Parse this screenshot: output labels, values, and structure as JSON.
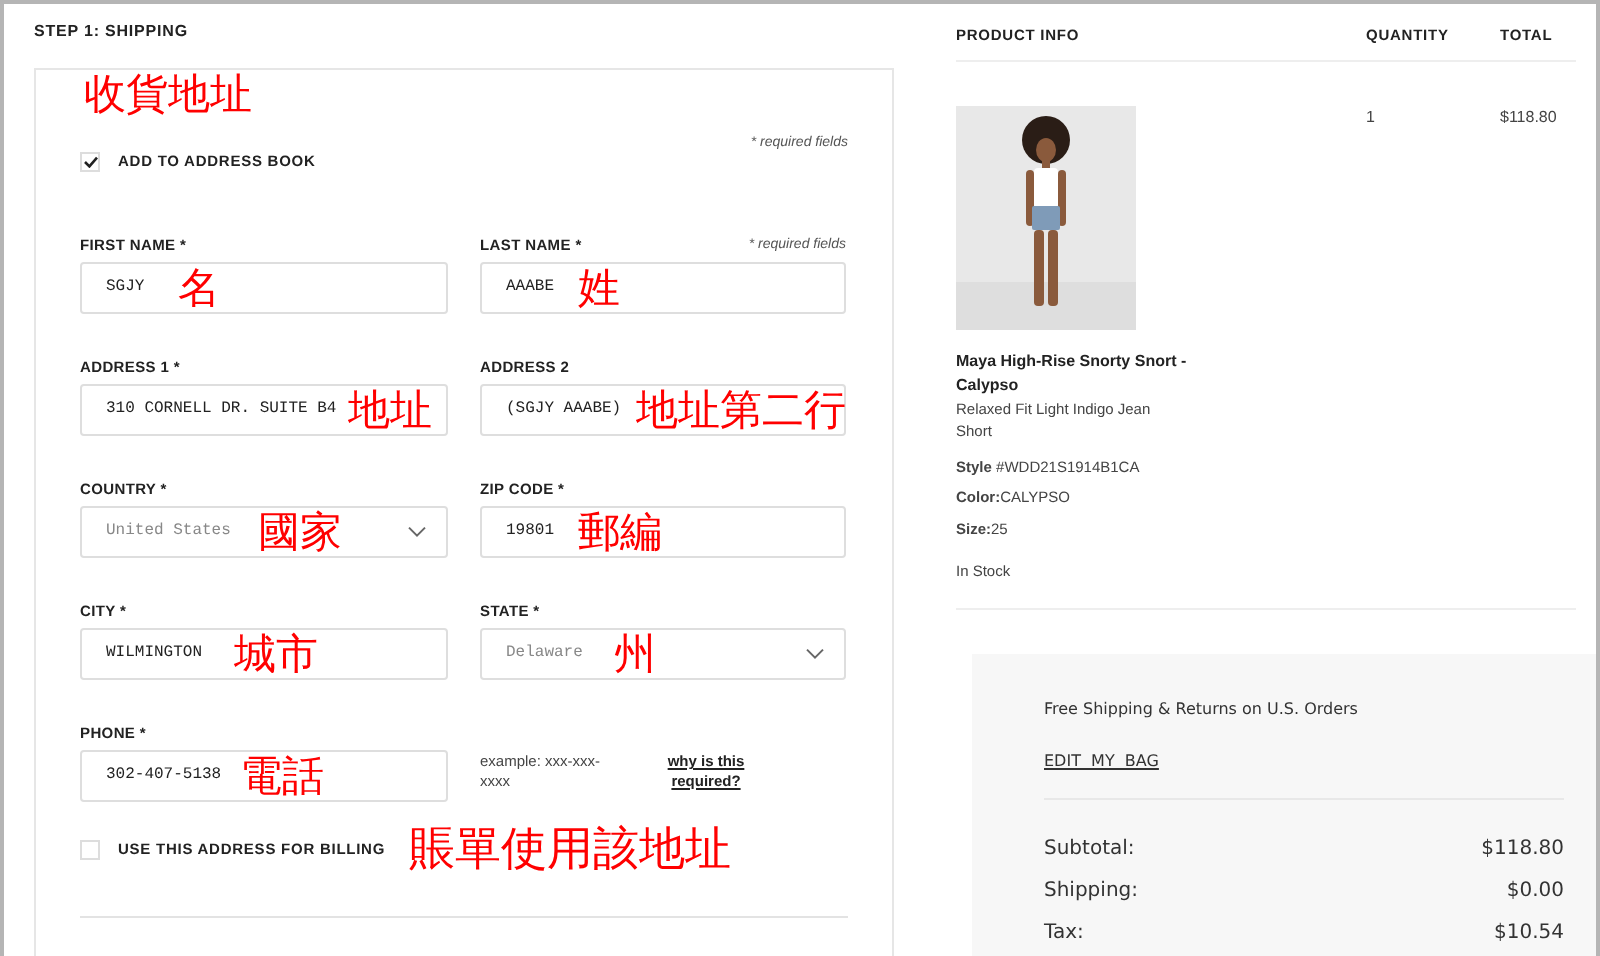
{
  "step_title": "STEP 1: SHIPPING",
  "form": {
    "annotation": "收貨地址",
    "required_note": "* required fields",
    "add_to_address_book": {
      "label": "ADD TO ADDRESS BOOK",
      "checked": true
    },
    "fields": [
      {
        "kind": "text",
        "label": "FIRST NAME *",
        "value": "SGJY",
        "annotation": "名"
      },
      {
        "kind": "text",
        "label": "LAST NAME *",
        "value": "AAABE",
        "annotation": "姓",
        "note": "* required fields"
      },
      {
        "kind": "text",
        "label": "ADDRESS 1 *",
        "value": "310 CORNELL DR. SUITE B4",
        "annotation": "地址"
      },
      {
        "kind": "text",
        "label": "ADDRESS 2",
        "value": "(SGJY AAABE)",
        "annotation": "地址第二行"
      },
      {
        "kind": "select",
        "label": "COUNTRY *",
        "value": "United States",
        "annotation": "國家"
      },
      {
        "kind": "text",
        "label": "ZIP CODE *",
        "value": "19801",
        "annotation": "郵編"
      },
      {
        "kind": "text",
        "label": "CITY *",
        "value": "WILMINGTON",
        "annotation": "城市"
      },
      {
        "kind": "select",
        "label": "STATE *",
        "value": "Delaware",
        "annotation": "州"
      },
      {
        "kind": "text",
        "label": "PHONE *",
        "value": "302-407-5138",
        "annotation": "電話"
      },
      {
        "kind": "help",
        "hint": "example: xxx-xxx-xxxx",
        "link": "why is this required?"
      }
    ],
    "use_for_billing": {
      "label": "USE THIS ADDRESS FOR BILLING",
      "checked": false,
      "annotation": "賬單使用該地址"
    }
  },
  "cart": {
    "columns": [
      "PRODUCT INFO",
      "QUANTITY",
      "TOTAL"
    ],
    "items": [
      {
        "kind": "picture",
        "name": "Maya High-Rise Snorty Snort - Calypso",
        "subtitle": "Relaxed Fit Light Indigo Jean Short",
        "details": [
          "**Style** #WDD21S1914B1CA",
          "**Color:**CALYPSO",
          "**Size:**25"
        ],
        "availability": "In Stock",
        "quantity": "1",
        "total": "$118.80"
      }
    ]
  },
  "summary": {
    "note": "Free Shipping & Returns on U.S. Orders",
    "edit_link": "EDIT  MY  BAG",
    "lines": [
      {
        "label": "Subtotal:",
        "value": "$118.80"
      },
      {
        "label": "Shipping:",
        "value": "$0.00"
      },
      {
        "label": "Tax:",
        "value": "$10.54"
      }
    ]
  }
}
